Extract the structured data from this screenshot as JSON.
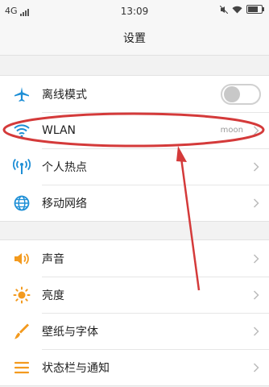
{
  "status_bar": {
    "network": "4G",
    "time": "13:09"
  },
  "header": {
    "title": "设置"
  },
  "groups": [
    {
      "items": [
        {
          "label": "离线模式",
          "control": "toggle",
          "toggle_on": false
        },
        {
          "label": "WLAN",
          "value": "moon",
          "control": "chevron"
        },
        {
          "label": "个人热点",
          "control": "chevron"
        },
        {
          "label": "移动网络",
          "control": "chevron"
        }
      ]
    },
    {
      "items": [
        {
          "label": "声音",
          "control": "chevron"
        },
        {
          "label": "亮度",
          "control": "chevron"
        },
        {
          "label": "壁纸与字体",
          "control": "chevron"
        },
        {
          "label": "状态栏与通知",
          "control": "chevron"
        }
      ]
    }
  ],
  "colors": {
    "accent": "#1e8fd6",
    "annotation": "#d43a3a",
    "orange_icon": "#f39a1e"
  }
}
